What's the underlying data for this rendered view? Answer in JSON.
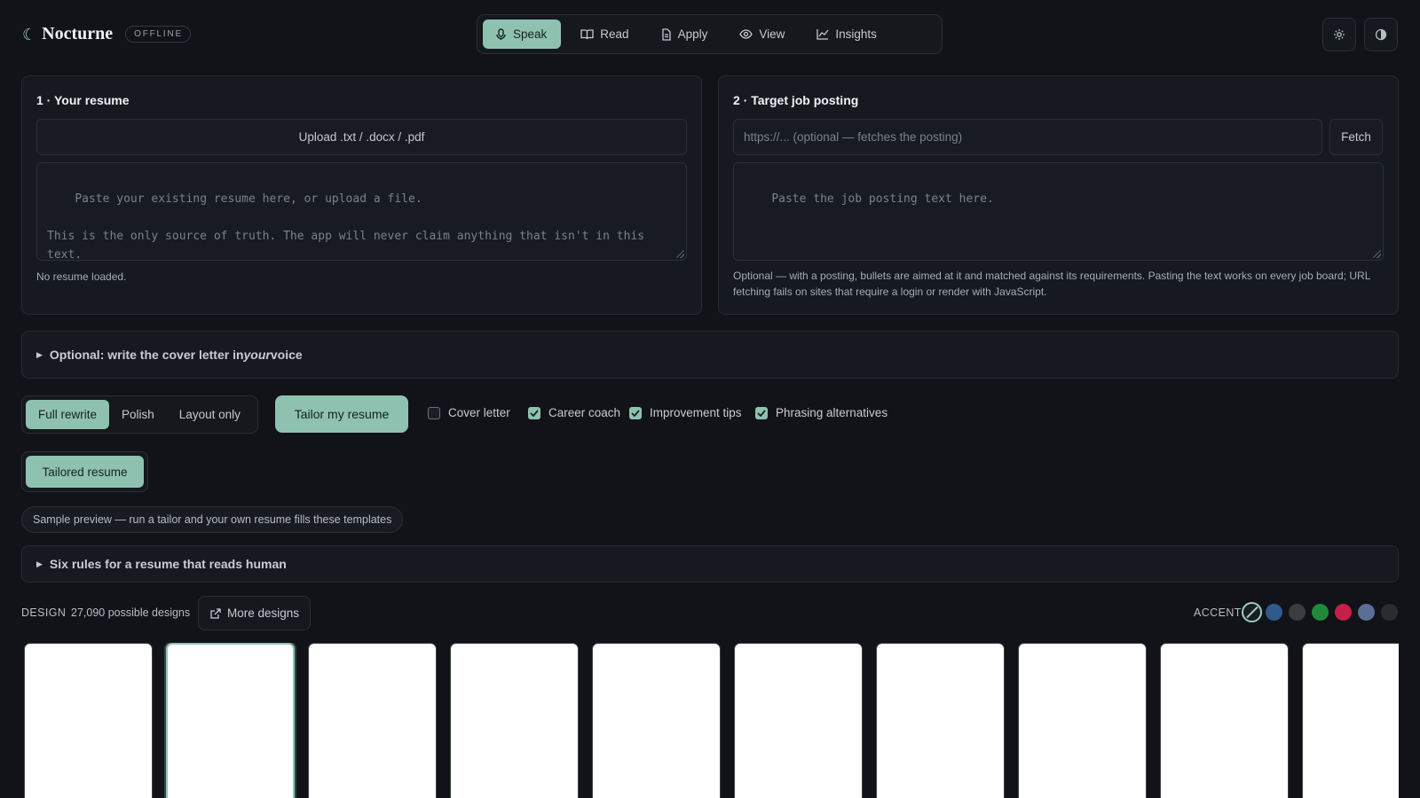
{
  "brand": {
    "name": "Nocturne",
    "badge": "OFFLINE"
  },
  "nav": {
    "items": [
      {
        "label": "Speak",
        "icon": "microphone-icon",
        "active": true
      },
      {
        "label": "Read",
        "icon": "book-icon",
        "active": false
      },
      {
        "label": "Apply",
        "icon": "document-icon",
        "active": false
      },
      {
        "label": "View",
        "icon": "eye-icon",
        "active": false
      },
      {
        "label": "Insights",
        "icon": "chart-icon",
        "active": false
      }
    ]
  },
  "header_actions": {
    "settings_icon": "gear-icon",
    "theme_icon": "contrast-icon"
  },
  "resume_panel": {
    "title": "1 · Your resume",
    "upload_label": "Upload .txt / .docx / .pdf",
    "textarea_placeholder": "Paste your existing resume here, or upload a file.\n\nThis is the only source of truth. The app will never claim anything that isn't in this text.",
    "status": "No resume loaded."
  },
  "job_panel": {
    "title": "2 · Target job posting",
    "url_placeholder": "https://... (optional — fetches the posting)",
    "fetch_label": "Fetch",
    "textarea_placeholder": "Paste the job posting text here.",
    "hint": "Optional — with a posting, bullets are aimed at it and matched against its requirements. Pasting the text works on every job board; URL fetching fails on sites that require a login or render with JavaScript."
  },
  "cover_letter_section": {
    "prefix": "Optional: write the cover letter in ",
    "emphasis": "your",
    "suffix": " voice"
  },
  "modes": {
    "options": [
      "Full rewrite",
      "Polish",
      "Layout only"
    ],
    "selected": "Full rewrite"
  },
  "tailor_button": "Tailor my resume",
  "options": [
    {
      "label": "Cover letter",
      "checked": false
    },
    {
      "label": "Career coach",
      "checked": true
    },
    {
      "label": "Improvement tips",
      "checked": true
    },
    {
      "label": "Phrasing alternatives",
      "checked": true
    }
  ],
  "result_tab": "Tailored resume",
  "sample_note": "Sample preview — run a tailor and your own resume fills these templates",
  "rules_section": "Six rules for a resume that reads human",
  "design": {
    "label": "DESIGN",
    "count": "27,090 possible designs",
    "more_label": "More designs",
    "accent_label": "ACCENT",
    "accent_colors": [
      "none",
      "#2f5a8a",
      "#3a3c40",
      "#1f8a3c",
      "#c4204a",
      "#5a6e96",
      "#2a2c30"
    ],
    "selected_accent": "none",
    "template_count": 10,
    "selected_template": 2
  }
}
